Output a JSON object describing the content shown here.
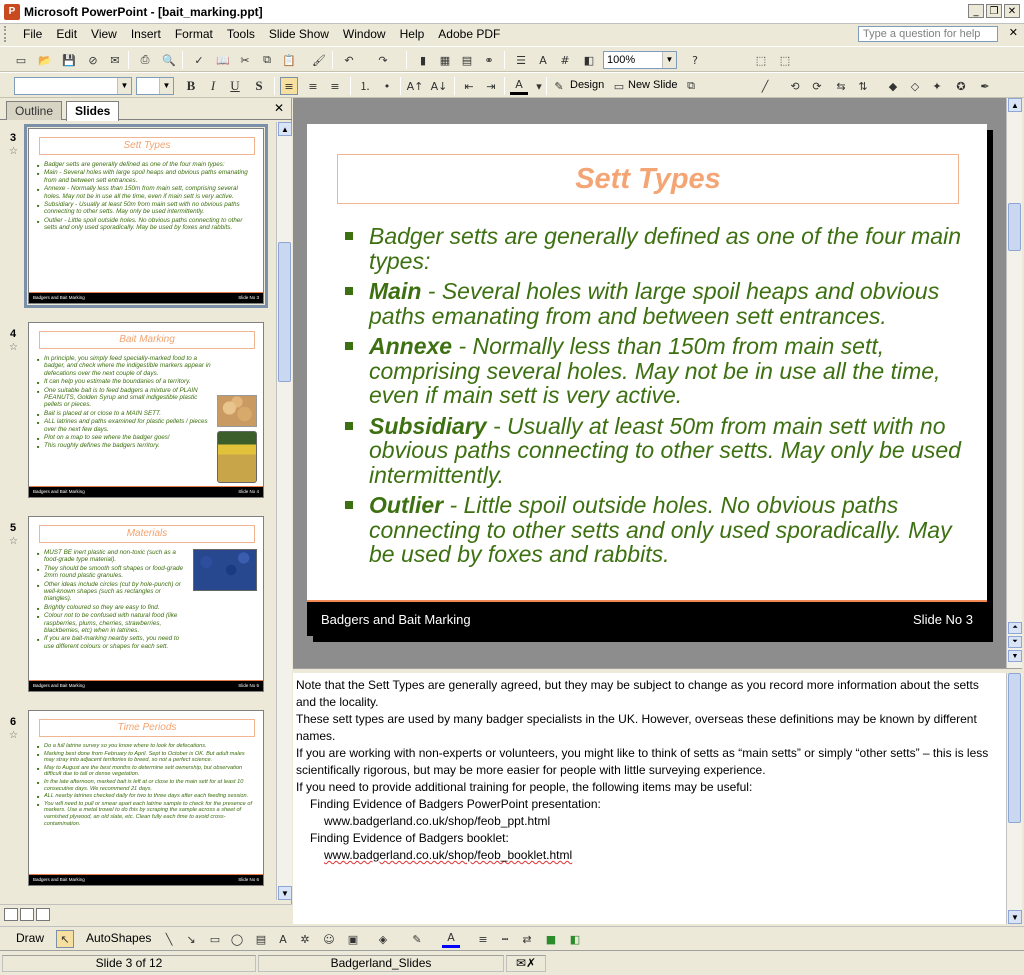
{
  "window": {
    "title": "Microsoft PowerPoint - [bait_marking.ppt]",
    "app_icon": "P"
  },
  "menu": {
    "items": [
      "File",
      "Edit",
      "View",
      "Insert",
      "Format",
      "Tools",
      "Slide Show",
      "Window",
      "Help",
      "Adobe PDF"
    ],
    "help_placeholder": "Type a question for help"
  },
  "toolbar": {
    "zoom": "100%",
    "font_name": "",
    "font_size": "",
    "design_label": "Design",
    "new_slide_label": "New Slide"
  },
  "panel": {
    "tab_outline": "Outline",
    "tab_slides": "Slides"
  },
  "thumbnails": [
    {
      "number": "3",
      "title": "Sett Types",
      "lines": [
        "Badger setts are generally defined as one of the four main types:",
        "Main - Several holes with large spoil heaps and obvious paths emanating from and between sett entrances.",
        "Annexe - Normally less than 150m from main sett, comprising several holes. May not be in use all the time, even if main sett is very active.",
        "Subsidiary - Usually at least 50m from main sett with no obvious paths connecting to other setts. May only be used intermittently.",
        "Outlier - Little spoil outside holes. No obvious paths connecting to other setts and only used sporadically. May be used by foxes and rabbits."
      ],
      "footer_left": "Badgers and Bait Marking",
      "footer_right": "Slide No 3"
    },
    {
      "number": "4",
      "title": "Bait Marking",
      "lines": [
        "In principle, you simply feed specially-marked food to a badger, and check where the indigestible markers appear in defecations over the next couple of days.",
        "It can help you estimate the boundaries of a territory.",
        "One suitable bait is to feed badgers a mixture of PLAIN PEANUTS, Golden Syrup and small indigestible plastic pellets or pieces.",
        "Bait is placed at or close to a MAIN SETT.",
        "ALL latrines and paths examined for plastic pellets / pieces over the next few days.",
        "Plot on a map to see where the badger goes!",
        "This roughly defines the badgers territory."
      ],
      "footer_left": "Badgers and Bait Marking",
      "footer_right": "Slide No 4"
    },
    {
      "number": "5",
      "title": "Materials",
      "lines": [
        "MUST BE inert plastic and non-toxic (such as a food-grade type material).",
        "They should be smooth soft shapes or food-grade 2mm round plastic granules.",
        "Other ideas include circles (cut by hole-punch) or well-known shapes (such as rectangles or triangles).",
        "Brightly coloured so they are easy to find.",
        "Colour not to be confused with natural food (like raspberries, plums, cherries, strawberries, blackberries, etc) when in latrines.",
        "If you are bait-marking nearby setts, you need to use different colours or shapes for each sett."
      ],
      "footer_left": "Badgers and Bait Marking",
      "footer_right": "Slide No 5"
    },
    {
      "number": "6",
      "title": "Time Periods",
      "lines": [
        "Do a full latrine survey so you know where to look for defecations.",
        "Marking best done from February to April. Sept to October is OK. But adult males may stray into adjacent territories to breed, so not a perfect science.",
        "May to August are the best months to determine sett ownership, but observation difficult due to tall or dense vegetation.",
        "In the late afternoon, marked bait is left at or close to the main sett for at least 10 consecutive days. We recommend 21 days.",
        "ALL nearby latrines checked daily for two to three days after each feeding session.",
        "You will need to pull or smear apart each latrine sample to check for the presence of markers. Use a metal trowel to do this by scraping the sample across a sheet of varnished plywood, an old slate, etc. Clean fully each time to avoid cross-contamination."
      ],
      "footer_left": "Badgers and Bait Marking",
      "footer_right": "Slide No 6"
    }
  ],
  "slide": {
    "title": "Sett Types",
    "bullets": [
      {
        "term": "",
        "text": "Badger setts are generally defined as one of the four main types:"
      },
      {
        "term": "Main",
        "text": " - Several holes with large spoil heaps and obvious paths emanating from and between sett entrances."
      },
      {
        "term": "Annexe",
        "text": " - Normally less than 150m from main sett, comprising several holes. May not be in use all the time, even if main sett is very active."
      },
      {
        "term": "Subsidiary",
        "text": " - Usually at least 50m from main sett with no obvious paths connecting to other setts. May only be used intermittently."
      },
      {
        "term": "Outlier",
        "text": " - Little spoil outside holes. No obvious paths connecting to other setts and only used sporadically. May be used by foxes and rabbits."
      }
    ],
    "footer_left": "Badgers and Bait Marking",
    "footer_right": "Slide No 3"
  },
  "notes": {
    "p1": "Note that the Sett Types are generally agreed, but they may be subject to change as you record more information about the setts and the locality.",
    "p2": "These sett types are used by many badger specialists in the UK. However, overseas these definitions may be known by different names.",
    "p3": "If you are working with non-experts or volunteers, you might like to think of setts as “main setts” or simply “other setts” – this is less scientifically rigorous, but may be more easier for people with little surveying experience.",
    "p4": "If you need to provide additional training for people, the following items may be useful:",
    "item1": "Finding Evidence of Badgers PowerPoint presentation:",
    "link1": "www.badgerland.co.uk/shop/feob_ppt.html",
    "item2": "Finding Evidence of Badgers booklet:",
    "link2": "www.badgerland.co.uk/shop/feob_booklet.html"
  },
  "drawing_toolbar": {
    "draw_label": "Draw",
    "autoshapes_label": "AutoShapes"
  },
  "status": {
    "slide_position": "Slide 3 of 12",
    "design_name": "Badgerland_Slides"
  }
}
